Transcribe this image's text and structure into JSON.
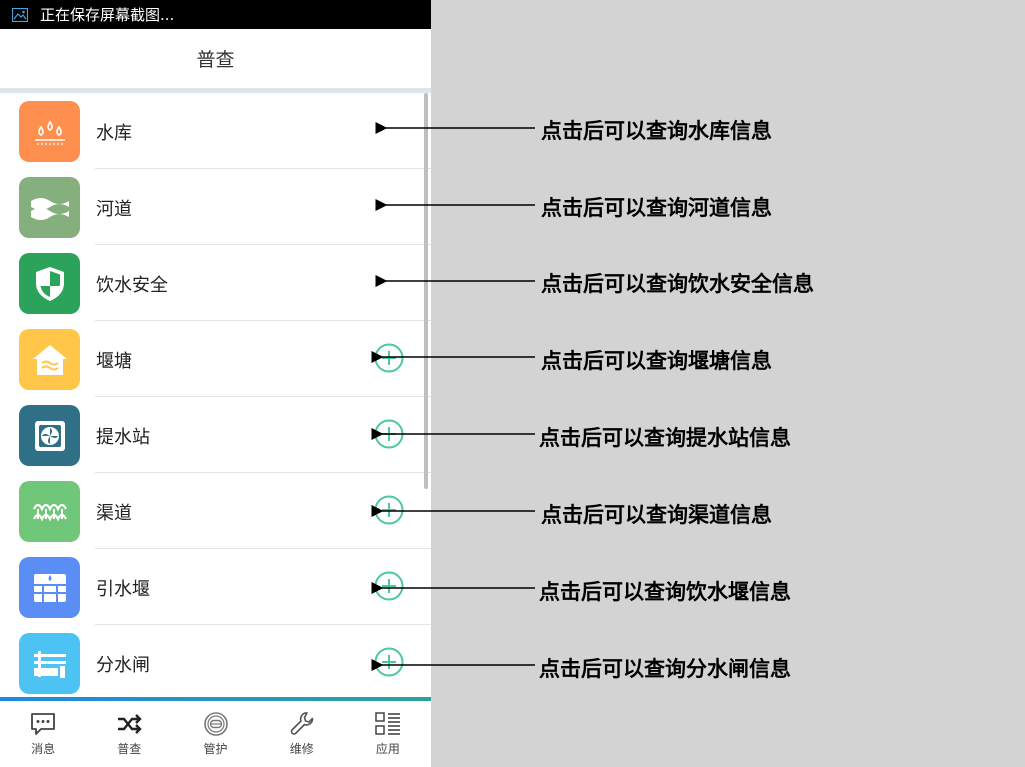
{
  "status_bar": {
    "icon": "screenshot-icon",
    "text": "正在保存屏幕截图..."
  },
  "header": {
    "title": "普查"
  },
  "items": [
    {
      "label": "水库",
      "icon": "droplets-icon",
      "color": "#ff8f4f",
      "has_add": false,
      "note": "点击后可以查询水库信息"
    },
    {
      "label": "河道",
      "icon": "waves-icon",
      "color": "#85b07e",
      "has_add": false,
      "note": "点击后可以查询河道信息"
    },
    {
      "label": "饮水安全",
      "icon": "shield-icon",
      "color": "#2ba35a",
      "has_add": false,
      "note": "点击后可以查询饮水安全信息"
    },
    {
      "label": "堰塘",
      "icon": "house-water-icon",
      "color": "#ffc64a",
      "has_add": true,
      "note": "点击后可以查询堰塘信息"
    },
    {
      "label": "提水站",
      "icon": "fan-icon",
      "color": "#2f7086",
      "has_add": true,
      "note": "点击后可以查询提水站信息"
    },
    {
      "label": "渠道",
      "icon": "channel-icon",
      "color": "#71c779",
      "has_add": true,
      "note": "点击后可以查询渠道信息"
    },
    {
      "label": "引水堰",
      "icon": "weir-icon",
      "color": "#5b8ef5",
      "has_add": true,
      "note": "点击后可以查询饮水堰信息"
    },
    {
      "label": "分水闸",
      "icon": "sluice-icon",
      "color": "#4cc3f2",
      "has_add": true,
      "note": "点击后可以查询分水闸信息"
    }
  ],
  "add_button": {
    "icon": "plus-circle-icon",
    "color": "#4cc8a0"
  },
  "tabs": [
    {
      "label": "消息",
      "icon": "message-icon"
    },
    {
      "label": "普查",
      "icon": "shuffle-icon"
    },
    {
      "label": "管护",
      "icon": "protect-icon"
    },
    {
      "label": "维修",
      "icon": "wrench-icon"
    },
    {
      "label": "应用",
      "icon": "apps-icon"
    }
  ]
}
